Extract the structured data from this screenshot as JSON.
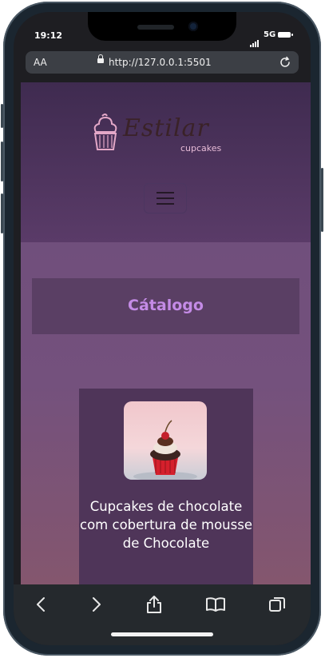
{
  "status_bar": {
    "time": "19:12",
    "network": "5G"
  },
  "browser": {
    "text_size_label": "AA",
    "url": "http://127.0.0.1:5501"
  },
  "site": {
    "brand_script": "Estilar",
    "brand_sub": "cupcakes",
    "section_title": "Cátalogo",
    "product": {
      "title": "Cupcakes de chocolate com cobertura de mousse de Chocolate"
    }
  },
  "icons": [
    "lock-icon",
    "reload-icon",
    "hamburger-menu-icon",
    "back-icon",
    "forward-icon",
    "share-icon",
    "bookmarks-icon",
    "tabs-icon",
    "signal-icon",
    "battery-icon"
  ]
}
